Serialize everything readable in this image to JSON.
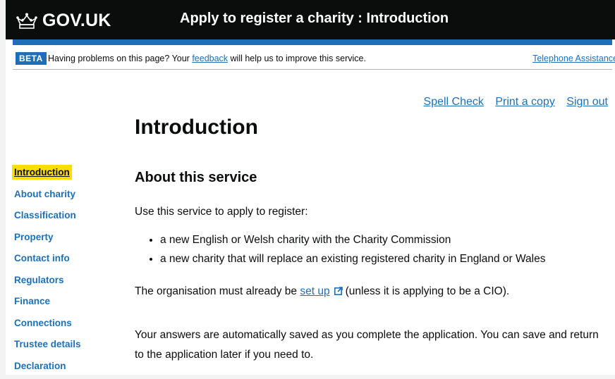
{
  "header": {
    "logo_text": "GOV.UK",
    "service_title": "Apply to register a charity : Introduction"
  },
  "beta": {
    "tag": "BETA",
    "message_before": "Having problems on this page? Your ",
    "feedback_link": "feedback",
    "message_after": " will help us to improve this service.",
    "telephone_link": "Telephone Assistance"
  },
  "toplinks": {
    "spell_check": "Spell Check",
    "print": "Print a copy",
    "sign_out": "Sign out"
  },
  "page_title": "Introduction",
  "section_title": "About this service",
  "nav": {
    "items": [
      {
        "label": "Introduction",
        "current": true
      },
      {
        "label": "About charity"
      },
      {
        "label": "Classification"
      },
      {
        "label": "Property"
      },
      {
        "label": "Contact info"
      },
      {
        "label": "Regulators"
      },
      {
        "label": "Finance"
      },
      {
        "label": "Connections"
      },
      {
        "label": "Trustee details"
      },
      {
        "label": "Declaration"
      }
    ]
  },
  "content": {
    "intro": "Use this service to apply to register:",
    "bullets": [
      "a new English or Welsh charity with the Charity Commission",
      "a new charity that will replace an existing registered charity in England or Wales"
    ],
    "org_before": "The organisation must already be ",
    "org_link": "set up",
    "org_after": "(unless it is applying to be a CIO).",
    "saved_text": "Your answers are automatically saved as you complete the application. You can save and return to the application later if you need to."
  },
  "colors": {
    "header_bg": "#0b0c0c",
    "brand_blue": "#1d70b8",
    "focus_yellow": "#ffdd00"
  }
}
